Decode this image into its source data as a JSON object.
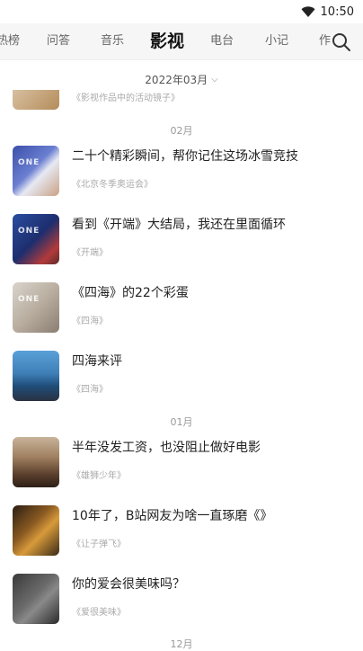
{
  "status": {
    "time": "10:50"
  },
  "tabs": [
    {
      "label": "热榜",
      "active": false
    },
    {
      "label": "问答",
      "active": false
    },
    {
      "label": "音乐",
      "active": false
    },
    {
      "label": "影视",
      "active": true
    },
    {
      "label": "电台",
      "active": false
    },
    {
      "label": "小记",
      "active": false
    },
    {
      "label": "作",
      "active": false
    }
  ],
  "date_filter": {
    "label": "2022年03月"
  },
  "partial_item": {
    "tag": "《影视作品中的活动镜子》"
  },
  "months": [
    "02月",
    "01月",
    "12月"
  ],
  "items": [
    {
      "title": "二十个精彩瞬间，帮你记住这场冰雪竞技",
      "tag": "《北京冬季奥运会》",
      "thumb_text": "ONE"
    },
    {
      "title": "看到《开端》大结局，我还在里面循环",
      "tag": "《开端》",
      "thumb_text": "ONE"
    },
    {
      "title": "《四海》的22个彩蛋",
      "tag": "《四海》",
      "thumb_text": "ONE"
    },
    {
      "title": "四海来评",
      "tag": "《四海》",
      "thumb_text": ""
    },
    {
      "title": "半年没发工资，也没阻止做好电影",
      "tag": "《雄狮少年》",
      "thumb_text": ""
    },
    {
      "title": "10年了，B站网友为啥一直琢磨《》",
      "tag": "《让子弹飞》",
      "thumb_text": ""
    },
    {
      "title": "你的爱会很美味吗？",
      "tag": "《爱很美味》",
      "thumb_text": ""
    }
  ]
}
